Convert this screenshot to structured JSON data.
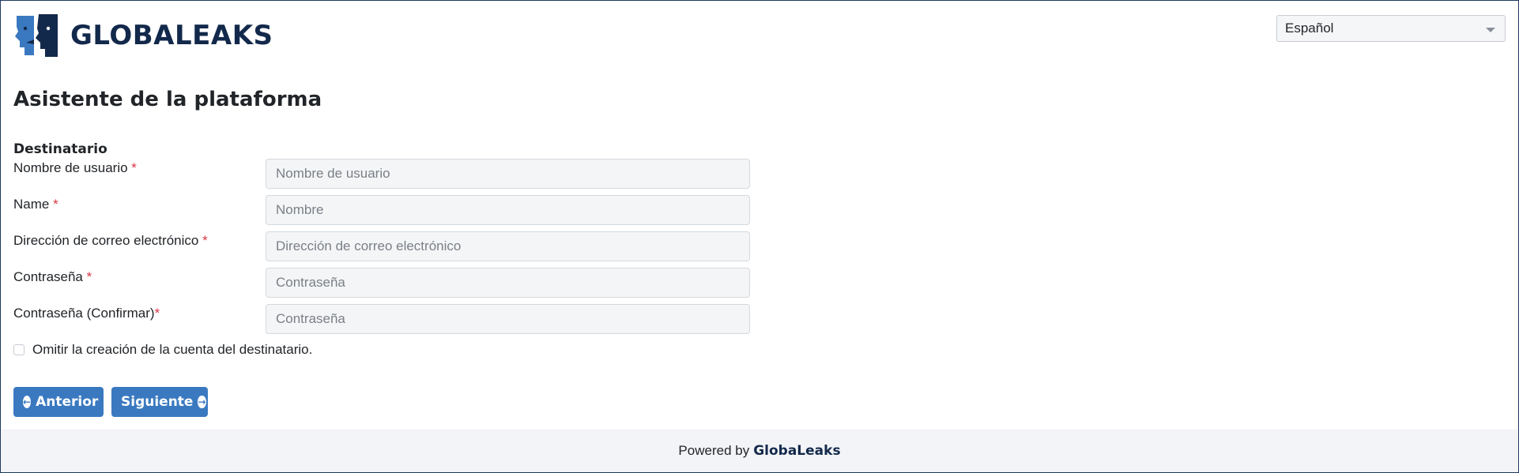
{
  "header": {
    "logo_text": "GLOBALEAKS",
    "language": "Español"
  },
  "page": {
    "title": "Asistente de la plataforma",
    "section": "Destinatario"
  },
  "form": {
    "fields": [
      {
        "label": "Nombre de usuario",
        "required_mark": " *",
        "placeholder": "Nombre de usuario"
      },
      {
        "label": "Name",
        "required_mark": " *",
        "placeholder": "Nombre"
      },
      {
        "label": "Dirección de correo electrónico",
        "required_mark": " *",
        "placeholder": "Dirección de correo electrónico"
      },
      {
        "label": "Contraseña",
        "required_mark": " *",
        "placeholder": "Contraseña"
      },
      {
        "label": "Contraseña (Confirmar)",
        "required_mark": "*",
        "placeholder": "Contraseña"
      }
    ],
    "skip_checkbox_label": "Omitir la creación de la cuenta del destinatario.",
    "skip_checked": false
  },
  "buttons": {
    "prev_label": "Anterior",
    "next_label": "Siguiente",
    "prev_icon": "arrow-circle-left-icon",
    "next_icon": "arrow-circle-right-icon"
  },
  "footer": {
    "prefix": "Powered by",
    "brand": "GlobaLeaks"
  },
  "colors": {
    "brand_dark": "#13294b",
    "brand_blue": "#3a79c0",
    "required": "#dc3545"
  }
}
